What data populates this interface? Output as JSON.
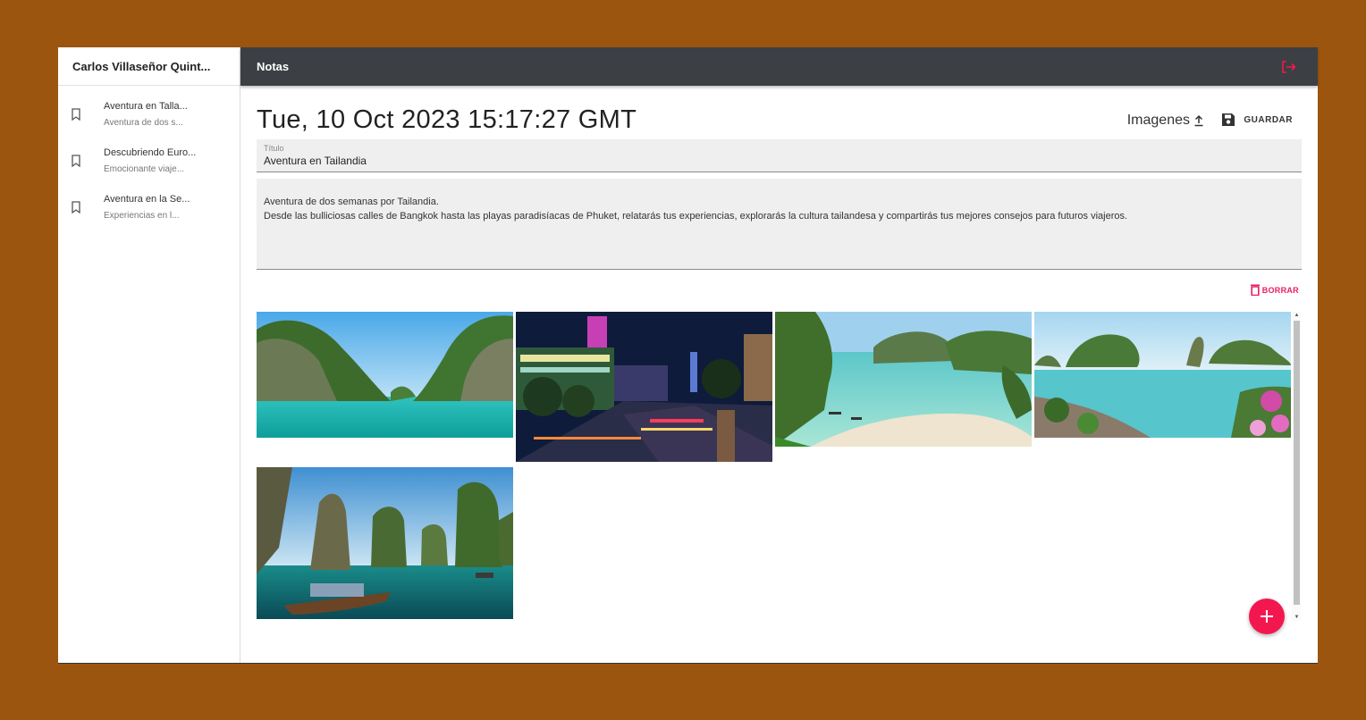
{
  "user": {
    "name": "Carlos Villaseñor Quint..."
  },
  "header": {
    "title": "Notas"
  },
  "notes": [
    {
      "title": "Aventura en Talla...",
      "preview": "Aventura de dos s..."
    },
    {
      "title": "Descubriendo Euro...",
      "preview": "Emocionante viaje..."
    },
    {
      "title": "Aventura en la Se...",
      "preview": "Experiencias en l..."
    }
  ],
  "note": {
    "date": "Tue, 10 Oct 2023 15:17:27 GMT",
    "title_label": "Título",
    "title_value": "Aventura en Tailandia",
    "body_line1": "Aventura de dos semanas por Tailandia.",
    "body_line2": "Desde las bulliciosas calles de Bangkok hasta las playas paradisíacas de Phuket, relatarás tus experiencias, explorarás la cultura tailandesa y compartirás tus mejores consejos para futuros viajeros."
  },
  "actions": {
    "images_label": "Imagenes",
    "save_label": "GUARDAR",
    "delete_label": "BORRAR"
  },
  "colors": {
    "frame": "#9c550e",
    "topbar": "#3c3f44",
    "accent": "#f2184f"
  },
  "gallery": [
    {
      "name": "photo-thailand-cliffs-lagoon"
    },
    {
      "name": "photo-bangkok-night-street"
    },
    {
      "name": "photo-thailand-beach-bay"
    },
    {
      "name": "photo-phang-nga-james-bond-island"
    },
    {
      "name": "photo-longtail-boat-limestone-karsts"
    }
  ]
}
